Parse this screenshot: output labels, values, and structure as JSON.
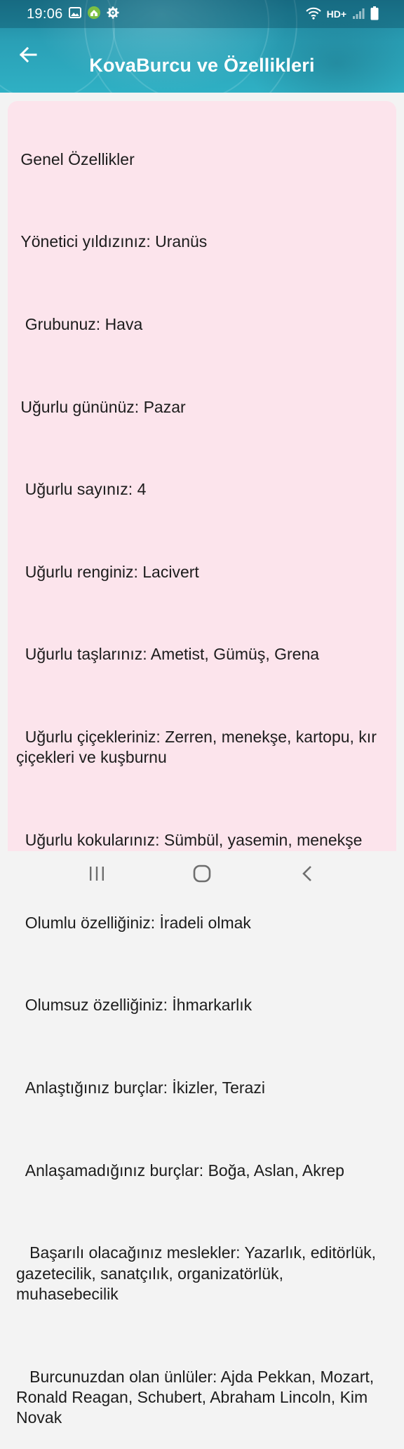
{
  "status_bar": {
    "time": "19:06",
    "network_label": "HD+",
    "icons_left": [
      "gallery-icon",
      "home-app-icon",
      "settings-gear-icon"
    ],
    "icons_right": [
      "wifi-icon",
      "signal-icon",
      "battery-icon"
    ]
  },
  "app_bar": {
    "back_icon": "arrow-left-icon",
    "title": "KovaBurcu ve Özellikleri"
  },
  "content": {
    "paragraphs": [
      " Genel Özellikler",
      " Yönetici yıldızınız: Uranüs",
      "  Grubunuz: Hava",
      " Uğurlu gününüz: Pazar",
      "  Uğurlu sayınız: 4",
      "  Uğurlu renginiz: Lacivert",
      "  Uğurlu taşlarınız: Ametist, Gümüş, Grena",
      "  Uğurlu çiçekleriniz: Zerren, menekşe, kartopu, kır çiçekleri ve kuşburnu",
      "  Uğurlu kokularınız: Sümbül, yasemin, menekşe",
      "  Olumlu özelliğiniz: İradeli olmak",
      "  Olumsuz özelliğiniz: İhmarkarlık",
      "  Anlaştığınız burçlar: İkizler, Terazi",
      "  Anlaşamadığınız burçlar: Boğa, Aslan, Akrep",
      "   Başarılı olacağınız meslekler: Yazarlık, editörlük, gazetecilik, sanatçılık, organizatörlük, muhasebecilik",
      "   Burcunuzdan olan ünlüler: Ajda Pekkan, Mozart, Ronald Reagan, Schubert, Abraham Lincoln, Kim Novak"
    ]
  },
  "colors": {
    "header": "#2aa0b6",
    "card_background": "#fce4ec",
    "text": "#1c1c1c",
    "nav_background": "#f3f3f3"
  },
  "navigation_bar": {
    "buttons": [
      "recent-apps-icon",
      "home-icon",
      "back-chevron-icon"
    ]
  }
}
